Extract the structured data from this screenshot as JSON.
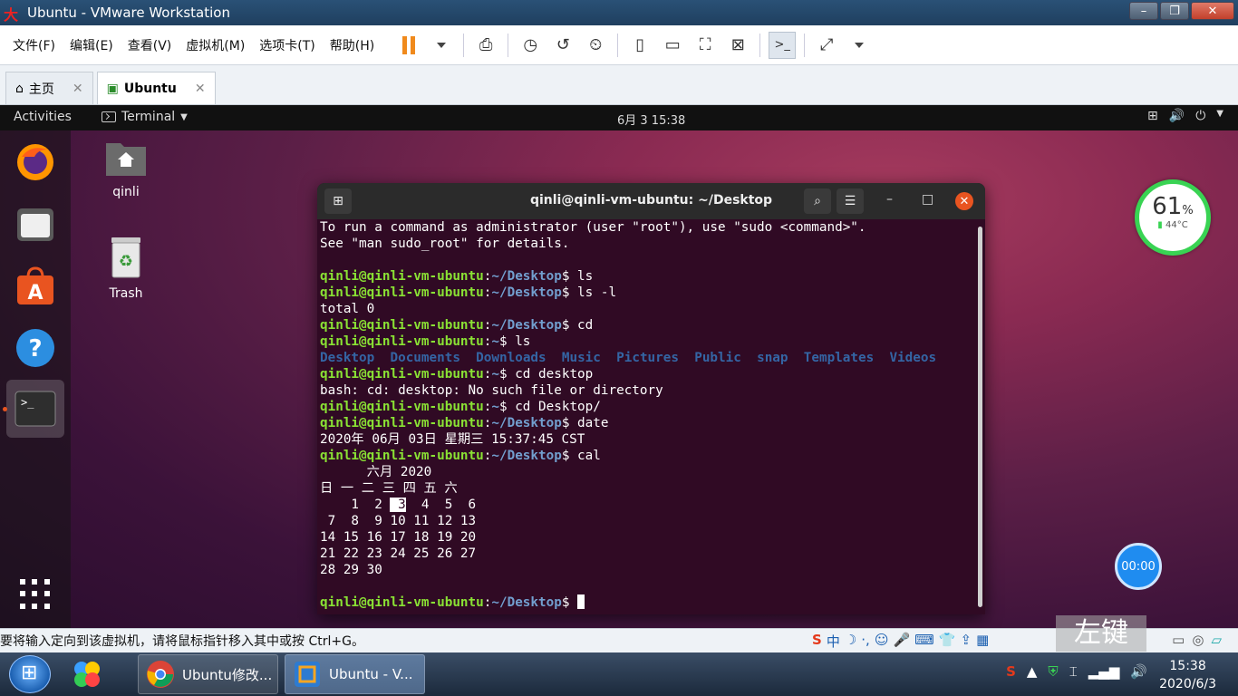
{
  "window": {
    "title": "Ubuntu - VMware Workstation",
    "logo_text": "大熊"
  },
  "menu": [
    "文件(F)",
    "编辑(E)",
    "查看(V)",
    "虚拟机(M)",
    "选项卡(T)",
    "帮助(H)"
  ],
  "tabs": [
    {
      "label": "主页",
      "icon": "home-icon"
    },
    {
      "label": "Ubuntu",
      "icon": "vm-icon"
    }
  ],
  "gnome": {
    "activities": "Activities",
    "app_menu": "Terminal",
    "clock": "6月 3  15:38"
  },
  "desktop": {
    "icons": [
      {
        "label": "qinli",
        "icon": "home-folder-icon"
      },
      {
        "label": "Trash",
        "icon": "trash-icon"
      }
    ]
  },
  "terminal": {
    "title": "qinli@qinli-vm-ubuntu: ~/Desktop",
    "prompt_user": "qinli@qinli-vm-ubuntu",
    "lines": [
      {
        "t": "text",
        "v": "To run a command as administrator (user \"root\"), use \"sudo <command>\"."
      },
      {
        "t": "text",
        "v": "See \"man sudo_root\" for details."
      },
      {
        "t": "text",
        "v": ""
      },
      {
        "t": "prompt",
        "path": "~/Desktop",
        "cmd": " ls"
      },
      {
        "t": "prompt",
        "path": "~/Desktop",
        "cmd": " ls -l"
      },
      {
        "t": "text",
        "v": "total 0"
      },
      {
        "t": "prompt",
        "path": "~/Desktop",
        "cmd": " cd"
      },
      {
        "t": "prompt",
        "path": "~",
        "cmd": " ls"
      },
      {
        "t": "dirs",
        "v": [
          "Desktop",
          "Documents",
          "Downloads",
          "Music",
          "Pictures",
          "Public",
          "snap",
          "Templates",
          "Videos"
        ]
      },
      {
        "t": "prompt",
        "path": "~",
        "cmd": " cd desktop"
      },
      {
        "t": "text",
        "v": "bash: cd: desktop: No such file or directory"
      },
      {
        "t": "prompt",
        "path": "~",
        "cmd": " cd Desktop/"
      },
      {
        "t": "prompt",
        "path": "~/Desktop",
        "cmd": " date"
      },
      {
        "t": "text",
        "v": "2020年 06月 03日 星期三 15:37:45 CST"
      },
      {
        "t": "prompt",
        "path": "~/Desktop",
        "cmd": " cal"
      },
      {
        "t": "text",
        "v": "      六月 2020"
      },
      {
        "t": "text",
        "v": "日 一 二 三 四 五 六"
      },
      {
        "t": "cal",
        "pre": "    1  2 ",
        "hl": " 3",
        "post": "  4  5  6"
      },
      {
        "t": "text",
        "v": " 7  8  9 10 11 12 13"
      },
      {
        "t": "text",
        "v": "14 15 16 17 18 19 20"
      },
      {
        "t": "text",
        "v": "21 22 23 24 25 26 27"
      },
      {
        "t": "text",
        "v": "28 29 30"
      },
      {
        "t": "text",
        "v": ""
      },
      {
        "t": "prompt",
        "path": "~/Desktop",
        "cmd": " ",
        "cursor": true
      }
    ]
  },
  "widgets": {
    "cpu_percent": "61",
    "cpu_unit": "%",
    "temperature": "44°C",
    "timer": "00:00"
  },
  "status_bar": {
    "message": "要将输入定向到该虚拟机，请将鼠标指针移入其中或按 Ctrl+G。",
    "watermark": "左键"
  },
  "taskbar": {
    "apps": [
      {
        "label": "Ubuntu修改...",
        "icon": "chrome-icon"
      },
      {
        "label": "Ubuntu - V...",
        "icon": "vmware-icon"
      }
    ],
    "time": "15:38",
    "date": "2020/6/3"
  },
  "colors": {
    "ubuntu_orange": "#e95420",
    "terminal_bg": "#300a24",
    "prompt_green": "#8ae234",
    "prompt_blue": "#729fcf"
  }
}
